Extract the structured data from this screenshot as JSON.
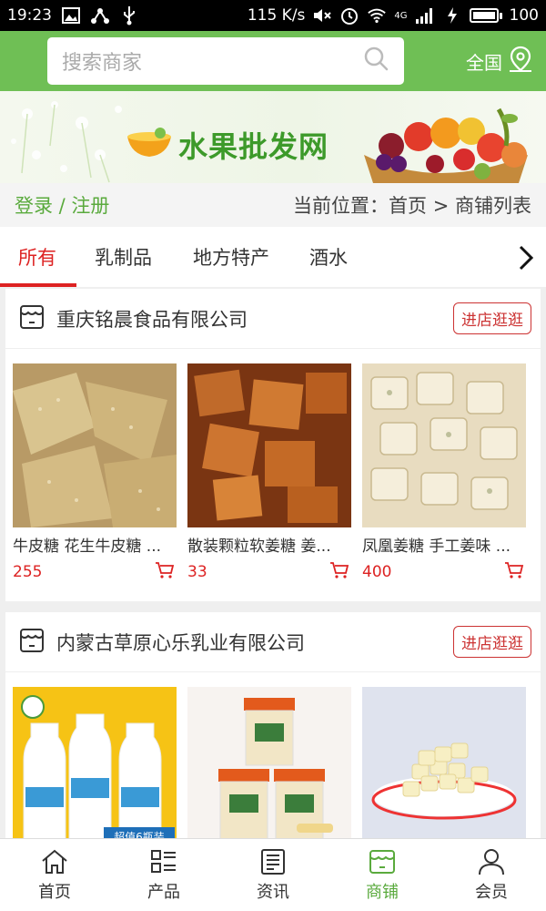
{
  "status_bar": {
    "time": "19:23",
    "speed": "115 K/s",
    "network": "4G",
    "battery": "100",
    "battery_level": 1.0
  },
  "header": {
    "search_placeholder": "搜索商家",
    "region_label": "全国"
  },
  "banner": {
    "brand": "水果批发网"
  },
  "breadcrumb": {
    "auth": "登录 / 注册",
    "location": "当前位置：首页 > 商铺列表"
  },
  "tabs": [
    {
      "label": "所有",
      "active": true
    },
    {
      "label": "乳制品",
      "active": false
    },
    {
      "label": "地方特产",
      "active": false
    },
    {
      "label": "酒水",
      "active": false
    }
  ],
  "shops": [
    {
      "name": "重庆铭晨食品有限公司",
      "enter_label": "进店逛逛",
      "products": [
        {
          "title": "牛皮糖 花生牛皮糖 ...",
          "price": "255"
        },
        {
          "title": "散装颗粒软姜糖 姜...",
          "price": "33"
        },
        {
          "title": "凤凰姜糖 手工姜味 ...",
          "price": "400"
        }
      ]
    },
    {
      "name": "内蒙古草原心乐乳业有限公司",
      "enter_label": "进店逛逛",
      "products": [
        {
          "title": "",
          "price": "",
          "image_text": "超值6瓶装"
        },
        {
          "title": "",
          "price": ""
        },
        {
          "title": "",
          "price": ""
        }
      ]
    }
  ],
  "bottom_nav": [
    {
      "label": "首页",
      "icon": "home-icon",
      "active": false
    },
    {
      "label": "产品",
      "icon": "list-icon",
      "active": false
    },
    {
      "label": "资讯",
      "icon": "news-icon",
      "active": false
    },
    {
      "label": "商铺",
      "icon": "shop-icon",
      "active": true
    },
    {
      "label": "会员",
      "icon": "user-icon",
      "active": false
    }
  ],
  "colors": {
    "header_green": "#6fbf55",
    "accent_red": "#dd2222",
    "active_green": "#5aaa3d"
  }
}
